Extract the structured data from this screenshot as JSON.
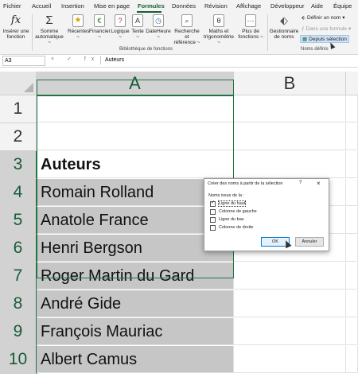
{
  "menu": {
    "tabs": [
      "Fichier",
      "Accueil",
      "Insertion",
      "Mise en page",
      "Formules",
      "Données",
      "Révision",
      "Affichage",
      "Développeur",
      "Aide",
      "Équipe"
    ],
    "active_index": 4
  },
  "ribbon": {
    "insert_function": {
      "line1": "Insérer une",
      "line2": "fonction"
    },
    "autosum": {
      "line1": "Somme",
      "line2": "automatique ~"
    },
    "recent": {
      "line1": "Récentes",
      "line2": "~"
    },
    "financial": {
      "line1": "Financier",
      "line2": "~"
    },
    "logical": {
      "line1": "Logique",
      "line2": "~"
    },
    "text": {
      "line1": "Texte",
      "line2": "~"
    },
    "datetime": {
      "line1": "DateHeure",
      "line2": "~"
    },
    "lookup": {
      "line1": "Recherche et",
      "line2": "référence ~"
    },
    "math": {
      "line1": "Maths et",
      "line2": "trigonométrie ~"
    },
    "more": {
      "line1": "Plus de",
      "line2": "fonctions ~"
    },
    "library_group": "Bibliothèque de fonctions",
    "name_manager": {
      "line1": "Gestionnaire",
      "line2": "de noms"
    },
    "define_name": "Définir un nom",
    "in_formula": "Dans une formule",
    "from_selection": "Depuis sélection",
    "names_group": "Noms définis"
  },
  "formula_bar": {
    "name_box": "A3",
    "icons": "× ✓ fx",
    "content": "Auteurs"
  },
  "sheet": {
    "columns": [
      "A",
      "B"
    ],
    "rows": [
      "1",
      "2",
      "3",
      "4",
      "5",
      "6",
      "7",
      "8",
      "9",
      "10"
    ],
    "cells": [
      "",
      "",
      "Auteurs",
      "Romain Rolland",
      "Anatole France",
      "Henri Bergson",
      "Roger Martin du Gard",
      "André Gide",
      "François Mauriac",
      "Albert Camus"
    ]
  },
  "dialog": {
    "title": "Créer des noms à partir de la sélection",
    "help": "?",
    "close": "×",
    "section": "Noms issus de la :",
    "options": [
      {
        "label": "Ligne du haut",
        "checked": true
      },
      {
        "label": "Colonne de gauche",
        "checked": false
      },
      {
        "label": "Ligne du bas",
        "checked": false
      },
      {
        "label": "Colonne de droite",
        "checked": false
      }
    ],
    "ok": "OK",
    "cancel": "Annuler"
  },
  "colors": {
    "accent": "#217346",
    "selection": "#c6c6c6",
    "tab_active": "#185c37"
  }
}
